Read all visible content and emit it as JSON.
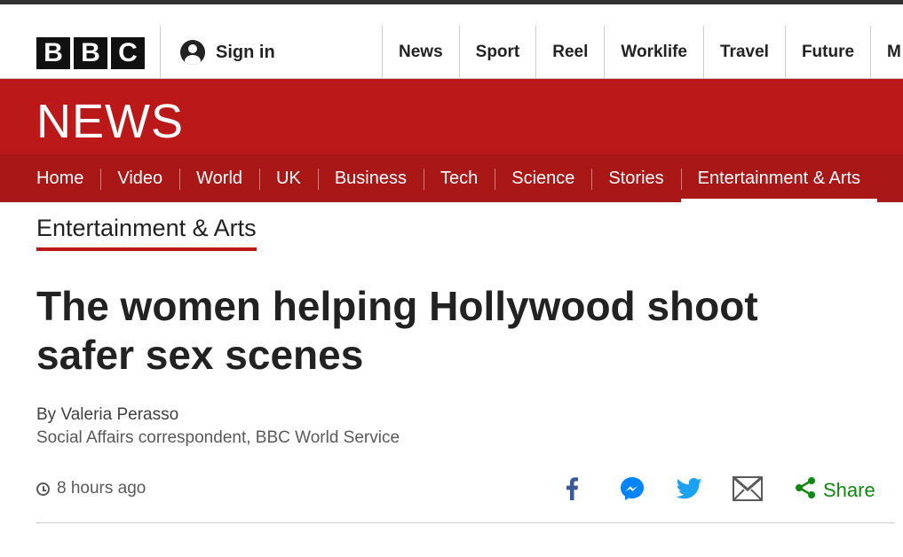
{
  "masthead": {
    "logo_letters": [
      "B",
      "B",
      "C"
    ],
    "sign_in_label": "Sign in",
    "nav": [
      "News",
      "Sport",
      "Reel",
      "Worklife",
      "Travel",
      "Future",
      "M"
    ]
  },
  "banner": {
    "title": "NEWS",
    "background_color": "#bb1919"
  },
  "subnav": {
    "items": [
      "Home",
      "Video",
      "World",
      "UK",
      "Business",
      "Tech",
      "Science",
      "Stories",
      "Entertainment & Arts"
    ],
    "active": "Entertainment & Arts"
  },
  "article": {
    "section": "Entertainment & Arts",
    "headline": "The women helping Hollywood shoot safer sex scenes",
    "byline_name": "By Valeria Perasso",
    "byline_role": "Social Affairs correspondent, BBC World Service",
    "timestamp": "8 hours ago"
  },
  "share": {
    "icons": [
      "facebook-icon",
      "messenger-icon",
      "twitter-icon",
      "email-icon",
      "share-icon"
    ],
    "label": "Share",
    "label_color": "#118811"
  }
}
